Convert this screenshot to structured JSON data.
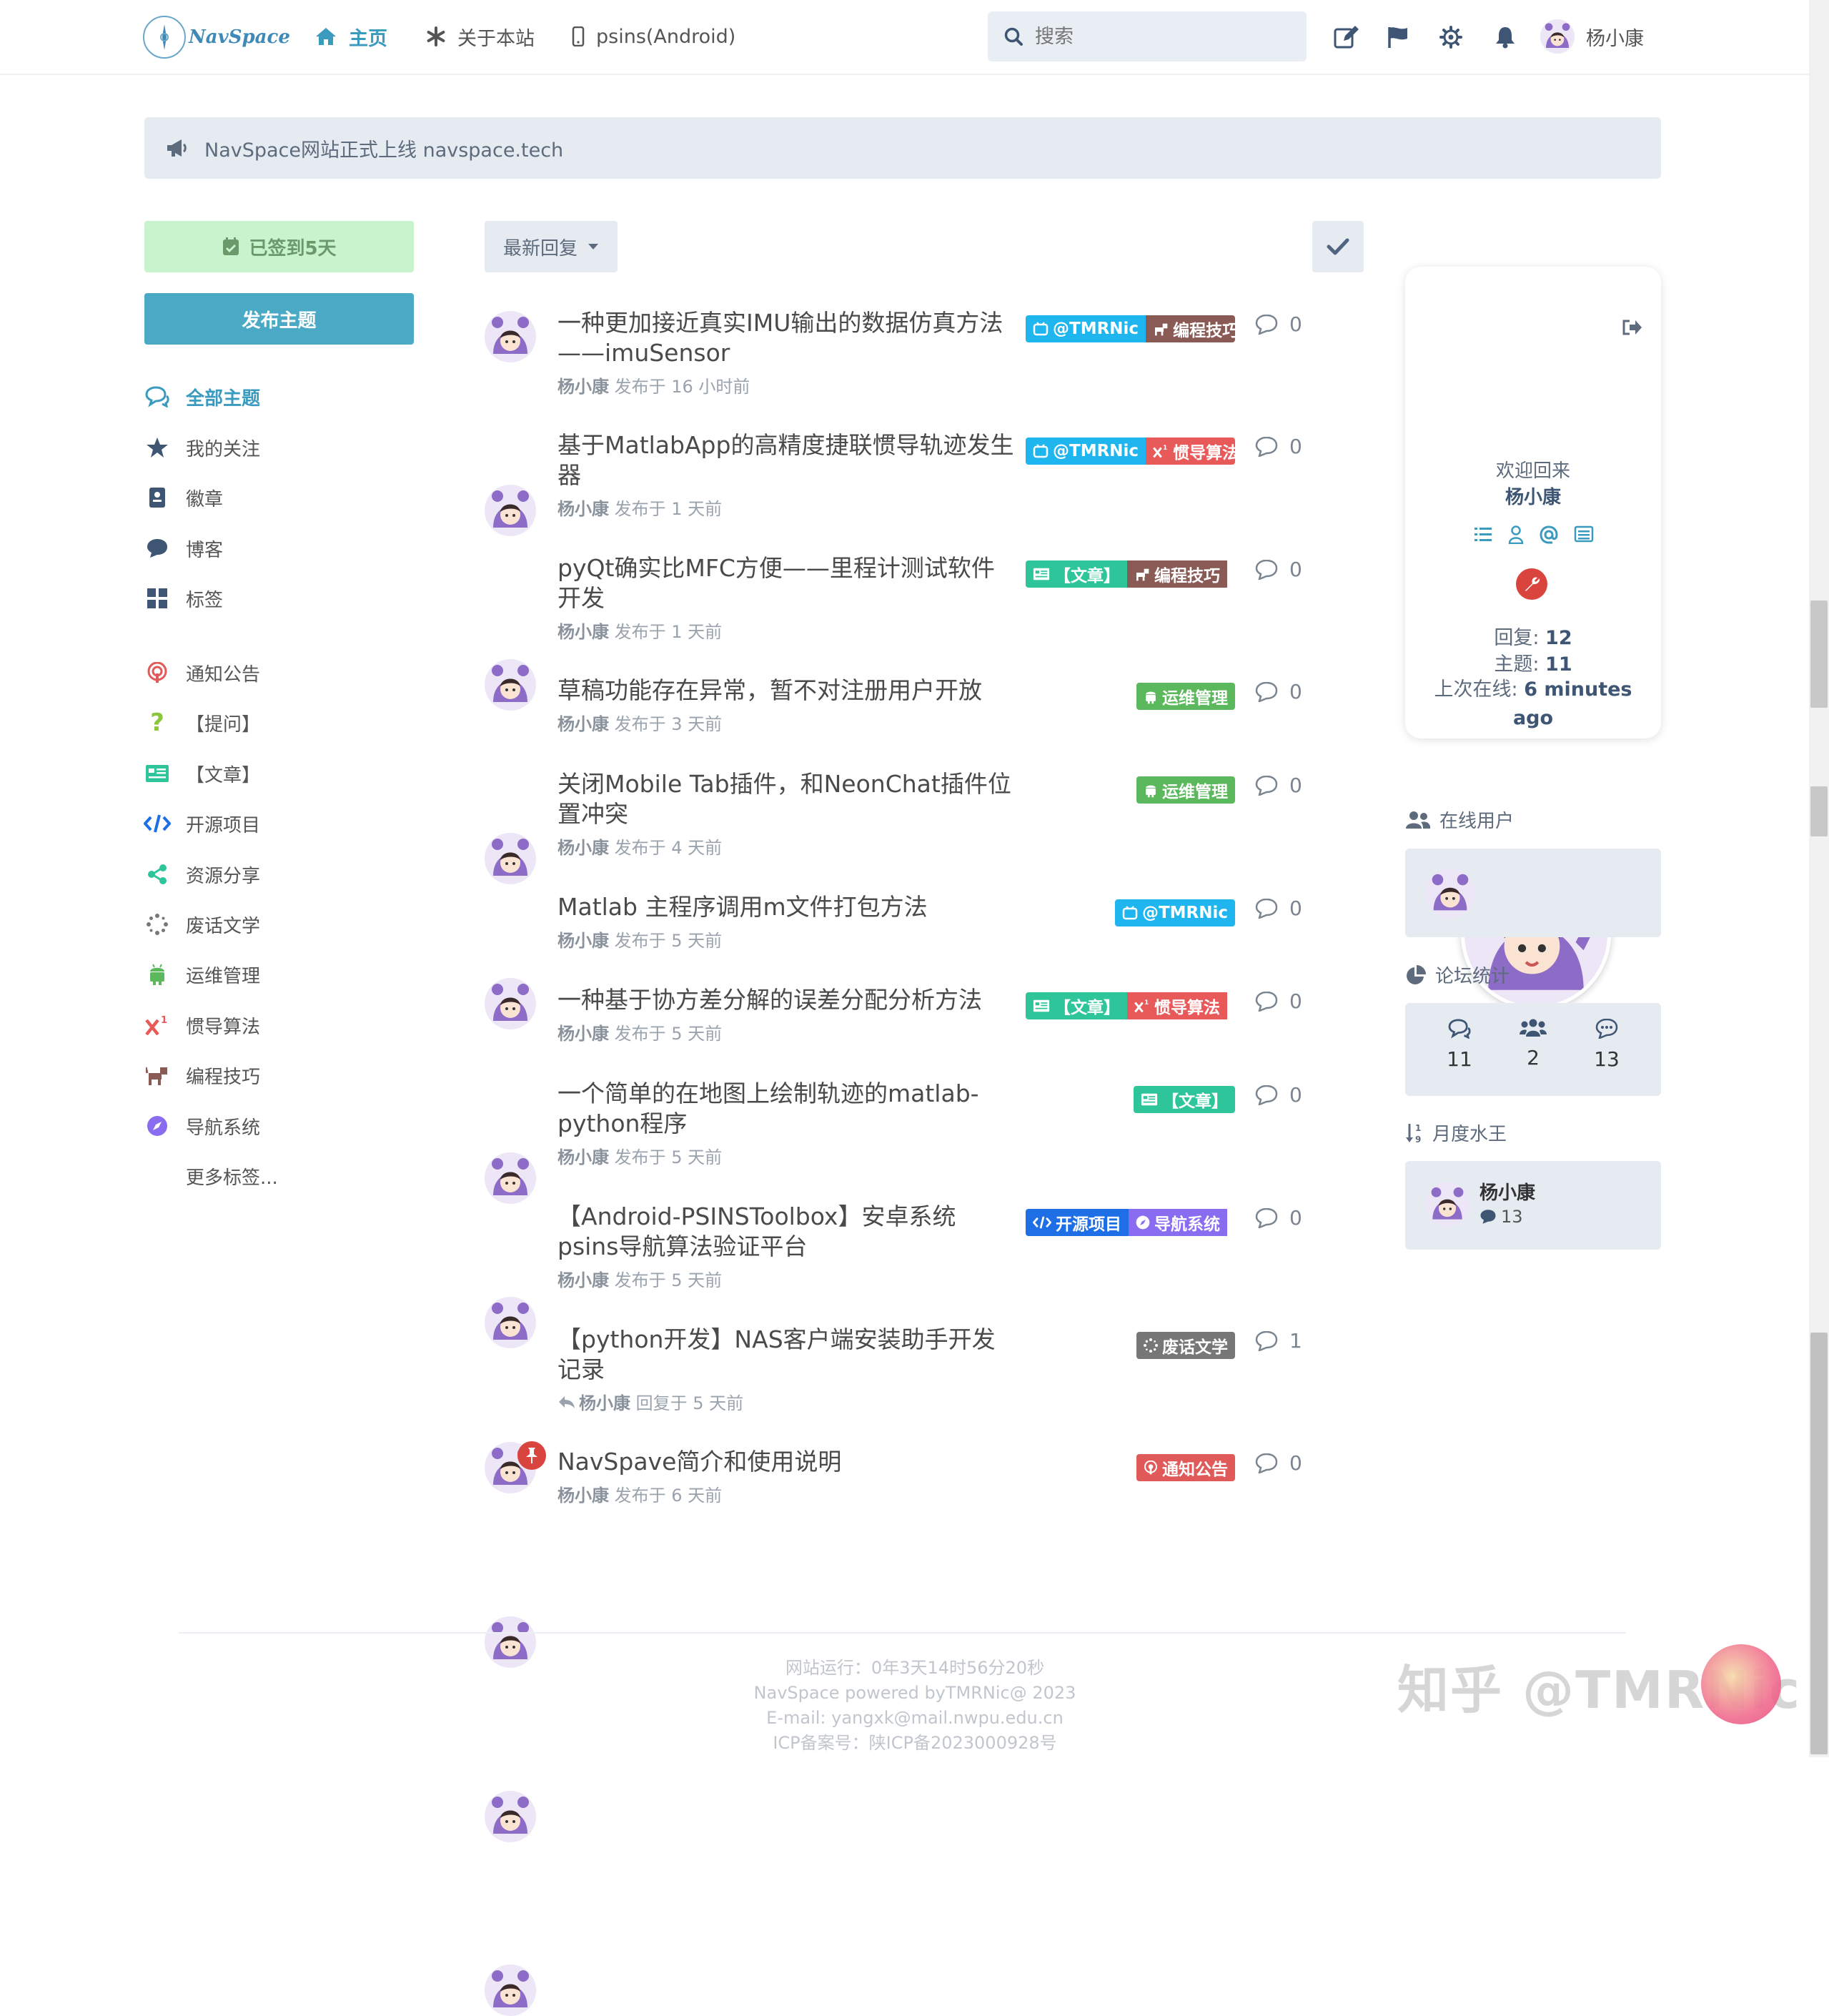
{
  "header": {
    "logo_text": "NavSpace",
    "nav": [
      {
        "label": "主页",
        "icon": "home-icon"
      },
      {
        "label": "关于本站",
        "icon": "asterisk-icon"
      },
      {
        "label": "psins(Android)",
        "icon": "mobile-icon"
      }
    ],
    "search_placeholder": "搜索",
    "user_name": "杨小康"
  },
  "announcement": "NavSpace网站正式上线 navspace.tech",
  "sidebar": {
    "checkin_label": "已签到5天",
    "post_label": "发布主题",
    "items": [
      {
        "label": "全部主题",
        "icon": "comments-icon"
      },
      {
        "label": "我的关注",
        "icon": "star-icon"
      },
      {
        "label": "徽章",
        "icon": "badge-icon"
      },
      {
        "label": "博客",
        "icon": "comment-icon"
      },
      {
        "label": "标签",
        "icon": "grid-icon"
      }
    ],
    "tags": [
      {
        "label": "通知公告",
        "icon": "podcast-icon",
        "color": "#e05a5a"
      },
      {
        "label": "【提问】",
        "icon": "question-icon",
        "color": "#8cc63f"
      },
      {
        "label": "【文章】",
        "icon": "newspaper-icon",
        "color": "#2fc59b"
      },
      {
        "label": "开源项目",
        "icon": "code-icon",
        "color": "#1e6ee6"
      },
      {
        "label": "资源分享",
        "icon": "share-icon",
        "color": "#2fc59b"
      },
      {
        "label": "废话文学",
        "icon": "spinner-icon",
        "color": "#777777"
      },
      {
        "label": "运维管理",
        "icon": "android-icon",
        "color": "#5cb85c"
      },
      {
        "label": "惯导算法",
        "icon": "superscript-icon",
        "color": "#e85a5a"
      },
      {
        "label": "编程技巧",
        "icon": "dog-icon",
        "color": "#8a5a55"
      },
      {
        "label": "导航系统",
        "icon": "compass-icon",
        "color": "#8a6cf0"
      }
    ],
    "more_tags": "更多标签..."
  },
  "toolbar": {
    "sort_label": "最新回复"
  },
  "discussions": [
    {
      "title": "一种更加接近真实IMU输出的数据仿真方法——imuSensor",
      "author": "杨小康",
      "action": "发布于 16 小时前",
      "tags": [
        {
          "label": "@TMRNic",
          "color": "#1fb5ef",
          "icon": "bilibili-icon"
        },
        {
          "label": "编程技巧",
          "color": "#8a5a55",
          "icon": "dog-icon"
        }
      ],
      "replies": "0"
    },
    {
      "title": "基于MatlabApp的高精度捷联惯导轨迹发生器",
      "author": "杨小康",
      "action": "发布于 1 天前",
      "tags": [
        {
          "label": "@TMRNic",
          "color": "#1fb5ef",
          "icon": "bilibili-icon"
        },
        {
          "label": "惯导算法",
          "color": "#e85a5a",
          "icon": "superscript-icon"
        }
      ],
      "replies": "0"
    },
    {
      "title": "pyQt确实比MFC方便——里程计测试软件开发",
      "author": "杨小康",
      "action": "发布于 1 天前",
      "tags": [
        {
          "label": "【文章】",
          "color": "#2fc59b",
          "icon": "newspaper-icon"
        },
        {
          "label": "编程技巧",
          "color": "#8a5a55",
          "icon": "dog-icon"
        }
      ],
      "replies": "0"
    },
    {
      "title": "草稿功能存在异常，暂不对注册用户开放",
      "author": "杨小康",
      "action": "发布于 3 天前",
      "tags": [
        {
          "label": "运维管理",
          "color": "#5cb85c",
          "icon": "android-icon"
        }
      ],
      "replies": "0"
    },
    {
      "title": "关闭Mobile Tab插件，和NeonChat插件位置冲突",
      "author": "杨小康",
      "action": "发布于 4 天前",
      "tags": [
        {
          "label": "运维管理",
          "color": "#5cb85c",
          "icon": "android-icon"
        }
      ],
      "replies": "0"
    },
    {
      "title": "Matlab 主程序调用m文件打包方法",
      "author": "杨小康",
      "action": "发布于 5 天前",
      "tags": [
        {
          "label": "@TMRNic",
          "color": "#1fb5ef",
          "icon": "bilibili-icon"
        }
      ],
      "replies": "0"
    },
    {
      "title": "一种基于协方差分解的误差分配分析方法",
      "author": "杨小康",
      "action": "发布于 5 天前",
      "tags": [
        {
          "label": "【文章】",
          "color": "#2fc59b",
          "icon": "newspaper-icon"
        },
        {
          "label": "惯导算法",
          "color": "#e85a5a",
          "icon": "superscript-icon"
        }
      ],
      "replies": "0"
    },
    {
      "title": "一个简单的在地图上绘制轨迹的matlab-python程序",
      "author": "杨小康",
      "action": "发布于 5 天前",
      "tags": [
        {
          "label": "【文章】",
          "color": "#2fc59b",
          "icon": "newspaper-icon"
        }
      ],
      "replies": "0"
    },
    {
      "title": "【Android-PSINSToolbox】安卓系统psins导航算法验证平台",
      "author": "杨小康",
      "action": "发布于 5 天前",
      "tags": [
        {
          "label": "开源项目",
          "color": "#1e6ee6",
          "icon": "code-icon"
        },
        {
          "label": "导航系统",
          "color": "#8a6cf0",
          "icon": "compass-icon"
        }
      ],
      "replies": "0"
    },
    {
      "title": "【python开发】NAS客户端安装助手开发记录",
      "author": "杨小康",
      "action": "回复于 5 天前",
      "tags": [
        {
          "label": "废话文学",
          "color": "#777777",
          "icon": "spinner-icon"
        }
      ],
      "replies": "1"
    },
    {
      "title": "NavSpave简介和使用说明",
      "author": "杨小康",
      "action": "发布于 6 天前",
      "tags": [
        {
          "label": "通知公告",
          "color": "#e05a5a",
          "icon": "podcast-icon"
        }
      ],
      "replies": "0"
    }
  ],
  "profile": {
    "welcome": "欢迎回来",
    "name": "杨小康",
    "replies_label": "回复: ",
    "replies_value": "12",
    "topics_label": "主题: ",
    "topics_value": "11",
    "last_seen_label": "上次在线: ",
    "last_seen_value": "6 minutes ago"
  },
  "online": {
    "title": "在线用户"
  },
  "forum_stats": {
    "title": "论坛统计",
    "discussions": "11",
    "users": "2",
    "posts": "13"
  },
  "monthly": {
    "title": "月度水王",
    "name": "杨小康",
    "count": "13"
  },
  "footer": {
    "lines": [
      "网站运行：0年3天14时56分20秒",
      "NavSpace powered byTMRNic@ 2023",
      "E-mail: yangxk@mail.nwpu.edu.cn",
      "ICP备案号：陕ICP备2023000928号"
    ]
  },
  "watermark": "知乎 @TMRNic"
}
